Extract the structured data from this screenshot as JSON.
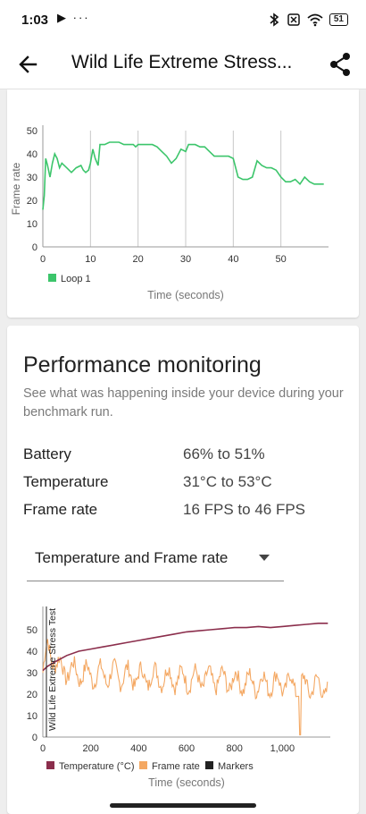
{
  "status_bar": {
    "time": "1:03",
    "left_icons": "▶ ···",
    "battery_level": "51"
  },
  "app_bar": {
    "title": "Wild Life Extreme Stress...",
    "back_icon": "arrow-left-icon",
    "share_icon": "share-icon"
  },
  "frame_rate_chart": {
    "chart_data": {
      "type": "line",
      "ylabel": "Frame rate",
      "xlabel": "Time (seconds)",
      "xlim": [
        0,
        60
      ],
      "ylim": [
        0,
        50
      ],
      "x_ticks": [
        0,
        10,
        20,
        30,
        40,
        50
      ],
      "y_ticks": [
        0,
        10,
        20,
        30,
        40,
        50
      ],
      "grid": "vertical",
      "legend_position": "bottom-left",
      "series": [
        {
          "name": "Loop 1",
          "color": "#3cc56b",
          "points": [
            [
              0,
              16
            ],
            [
              0.3,
              22
            ],
            [
              0.6,
              38
            ],
            [
              1,
              35
            ],
            [
              1.5,
              30
            ],
            [
              2,
              36
            ],
            [
              2.5,
              40
            ],
            [
              3,
              38
            ],
            [
              3.5,
              34
            ],
            [
              4,
              36
            ],
            [
              5,
              34
            ],
            [
              6,
              32
            ],
            [
              7,
              34
            ],
            [
              8,
              35
            ],
            [
              8.5,
              33
            ],
            [
              9,
              32
            ],
            [
              9.6,
              33
            ],
            [
              10,
              36
            ],
            [
              10.5,
              42
            ],
            [
              11,
              38
            ],
            [
              11.6,
              35
            ],
            [
              12,
              44
            ],
            [
              13,
              44
            ],
            [
              14,
              45
            ],
            [
              15,
              45
            ],
            [
              16,
              45
            ],
            [
              17,
              44
            ],
            [
              18,
              44
            ],
            [
              19,
              44
            ],
            [
              19.5,
              43
            ],
            [
              20,
              44
            ],
            [
              21,
              44
            ],
            [
              22,
              44
            ],
            [
              23,
              44
            ],
            [
              24,
              43
            ],
            [
              25,
              41
            ],
            [
              26,
              39
            ],
            [
              27,
              36
            ],
            [
              28,
              38
            ],
            [
              29,
              42
            ],
            [
              30,
              41
            ],
            [
              30.6,
              44
            ],
            [
              31,
              44
            ],
            [
              32,
              44
            ],
            [
              33,
              43
            ],
            [
              34,
              43
            ],
            [
              35,
              41
            ],
            [
              36,
              39
            ],
            [
              37,
              39
            ],
            [
              38,
              39
            ],
            [
              39,
              39
            ],
            [
              40,
              38
            ],
            [
              41,
              30
            ],
            [
              42,
              29
            ],
            [
              43,
              29
            ],
            [
              44,
              30
            ],
            [
              45,
              37
            ],
            [
              46,
              35
            ],
            [
              47,
              34
            ],
            [
              48,
              34
            ],
            [
              49,
              33
            ],
            [
              50,
              30
            ],
            [
              51,
              28
            ],
            [
              52,
              28
            ],
            [
              53,
              29
            ],
            [
              54,
              27
            ],
            [
              55,
              30
            ],
            [
              56,
              28
            ],
            [
              57,
              27
            ],
            [
              58,
              27
            ],
            [
              59,
              27
            ]
          ]
        }
      ]
    }
  },
  "performance": {
    "title": "Performance monitoring",
    "description": "See what was happening inside your device during your benchmark run.",
    "stats": [
      {
        "label": "Battery",
        "value": "66% to 51%"
      },
      {
        "label": "Temperature",
        "value": "31°C to 53°C"
      },
      {
        "label": "Frame rate",
        "value": "16 FPS to 46 FPS"
      }
    ],
    "dropdown_value": "Temperature and Frame rate"
  },
  "monitoring_chart": {
    "chart_data": {
      "type": "line",
      "xlabel": "Time (seconds)",
      "xlim": [
        0,
        1200
      ],
      "ylim": [
        0,
        55
      ],
      "x_ticks": [
        0,
        200,
        400,
        600,
        800,
        1000
      ],
      "x_tick_labels": [
        "0",
        "200",
        "400",
        "600",
        "800",
        "1,000"
      ],
      "y_ticks": [
        0,
        10,
        20,
        30,
        40,
        50
      ],
      "marker_label": "Wild Life Extreme Stress Test",
      "legend_position": "bottom",
      "series": [
        {
          "name": "Temperature (°C)",
          "color": "#8b2e4c",
          "points": [
            [
              0,
              31
            ],
            [
              20,
              33
            ],
            [
              50,
              35
            ],
            [
              100,
              38
            ],
            [
              150,
              40
            ],
            [
              200,
              41
            ],
            [
              250,
              42
            ],
            [
              300,
              43
            ],
            [
              350,
              44
            ],
            [
              400,
              45
            ],
            [
              450,
              46
            ],
            [
              500,
              47
            ],
            [
              550,
              48
            ],
            [
              600,
              49
            ],
            [
              650,
              49.5
            ],
            [
              700,
              50
            ],
            [
              750,
              50.5
            ],
            [
              800,
              51
            ],
            [
              850,
              51
            ],
            [
              900,
              51.5
            ],
            [
              950,
              51
            ],
            [
              1000,
              51.5
            ],
            [
              1050,
              52
            ],
            [
              1100,
              52.5
            ],
            [
              1150,
              53
            ],
            [
              1190,
              53
            ]
          ]
        },
        {
          "name": "Frame rate",
          "color": "#f4a863",
          "base": [
            [
              0,
              30
            ],
            [
              20,
              42
            ],
            [
              60,
              33
            ],
            [
              100,
              31
            ],
            [
              200,
              29
            ],
            [
              300,
              29
            ],
            [
              400,
              28
            ],
            [
              500,
              28
            ],
            [
              600,
              27
            ],
            [
              700,
              27
            ],
            [
              800,
              26
            ],
            [
              900,
              25
            ],
            [
              1000,
              25
            ],
            [
              1100,
              24
            ],
            [
              1190,
              23
            ]
          ],
          "dips": [
            [
              1075,
              1
            ]
          ]
        },
        {
          "name": "Markers",
          "color": "#222222"
        }
      ]
    }
  }
}
